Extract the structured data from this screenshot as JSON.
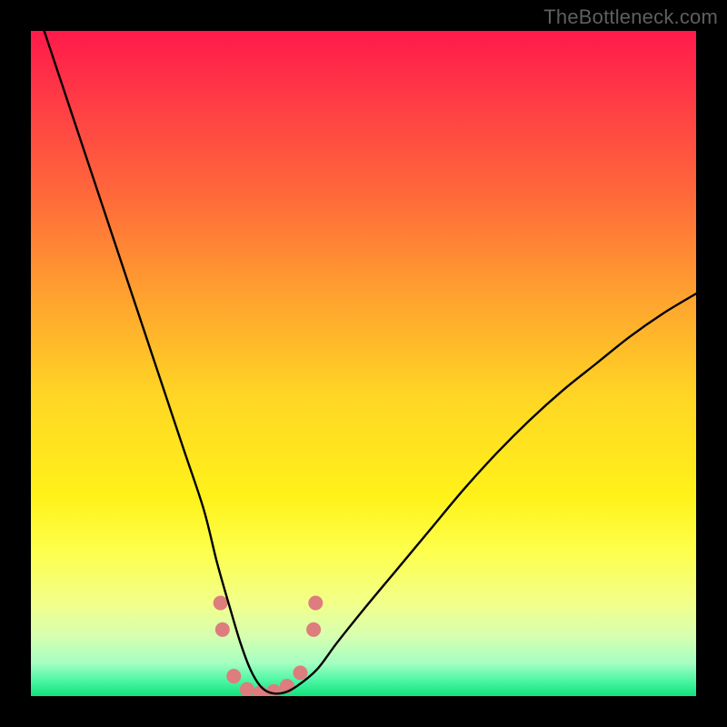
{
  "watermark": "TheBottleneck.com",
  "chart_data": {
    "type": "line",
    "title": "",
    "xlabel": "",
    "ylabel": "",
    "xlim": [
      0,
      100
    ],
    "ylim": [
      0,
      100
    ],
    "gradient_stops": [
      {
        "offset": 0.0,
        "color": "#ff1a4b"
      },
      {
        "offset": 0.1,
        "color": "#ff3a46"
      },
      {
        "offset": 0.25,
        "color": "#ff6a3a"
      },
      {
        "offset": 0.4,
        "color": "#ffa22f"
      },
      {
        "offset": 0.55,
        "color": "#ffd624"
      },
      {
        "offset": 0.7,
        "color": "#fff21a"
      },
      {
        "offset": 0.78,
        "color": "#fdff4a"
      },
      {
        "offset": 0.86,
        "color": "#f2ff8a"
      },
      {
        "offset": 0.91,
        "color": "#d6ffb0"
      },
      {
        "offset": 0.95,
        "color": "#a6ffc2"
      },
      {
        "offset": 0.975,
        "color": "#52f7a6"
      },
      {
        "offset": 1.0,
        "color": "#11e27c"
      }
    ],
    "series": [
      {
        "name": "bottleneck-curve",
        "x": [
          2,
          5,
          8,
          11,
          14,
          17,
          20,
          23,
          26,
          28,
          30,
          31.5,
          33,
          34.5,
          36,
          38,
          40,
          43,
          46,
          50,
          55,
          60,
          65,
          70,
          75,
          80,
          85,
          90,
          95,
          100
        ],
        "y": [
          100,
          91,
          82,
          73,
          64,
          55,
          46,
          37,
          28,
          20,
          13,
          8,
          4,
          1.5,
          0.5,
          0.5,
          1.5,
          4,
          8,
          13,
          19,
          25,
          31,
          36.5,
          41.5,
          46,
          50,
          54,
          57.5,
          60.5
        ]
      }
    ],
    "markers": {
      "name": "highlight-dots",
      "color": "#dd7d7d",
      "radius_px": 8,
      "points": [
        {
          "x": 28.5,
          "y": 14
        },
        {
          "x": 28.8,
          "y": 10
        },
        {
          "x": 30.5,
          "y": 3
        },
        {
          "x": 32.5,
          "y": 1
        },
        {
          "x": 34.5,
          "y": 0.5
        },
        {
          "x": 36.5,
          "y": 0.7
        },
        {
          "x": 38.5,
          "y": 1.5
        },
        {
          "x": 40.5,
          "y": 3.5
        },
        {
          "x": 42.5,
          "y": 10
        },
        {
          "x": 42.8,
          "y": 14
        }
      ]
    }
  }
}
